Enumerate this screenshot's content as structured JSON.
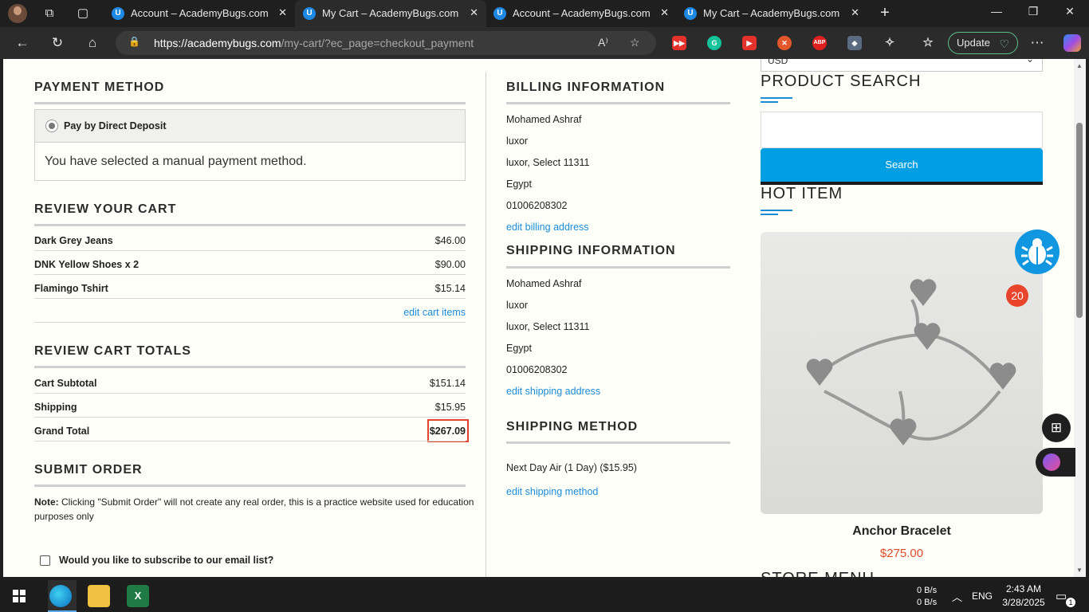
{
  "browser": {
    "tabs": [
      {
        "title": "Account – AcademyBugs.com",
        "active": false
      },
      {
        "title": "My Cart – AcademyBugs.com",
        "active": true
      },
      {
        "title": "Account – AcademyBugs.com",
        "active": false
      },
      {
        "title": "My Cart – AcademyBugs.com",
        "active": false
      }
    ],
    "url_host": "https://academybugs.com",
    "url_path": "/my-cart/?ec_page=checkout_payment",
    "update_label": "Update",
    "favicon_letter": "U",
    "ext_abp": "ABP"
  },
  "payment": {
    "heading": "PAYMENT METHOD",
    "option_label": "Pay by Direct Deposit",
    "message": "You have selected a manual payment method."
  },
  "cart": {
    "heading": "REVIEW YOUR CART",
    "items": [
      {
        "name": "Dark Grey Jeans",
        "price": "$46.00"
      },
      {
        "name": "DNK Yellow Shoes x 2",
        "price": "$90.00"
      },
      {
        "name": "Flamingo Tshirt",
        "price": "$15.14"
      }
    ],
    "edit_link": "edit cart items"
  },
  "totals": {
    "heading": "REVIEW CART TOTALS",
    "rows": [
      {
        "label": "Cart Subtotal",
        "value": "$151.14"
      },
      {
        "label": "Shipping",
        "value": "$15.95"
      },
      {
        "label": "Grand Total",
        "value": "$267.09"
      }
    ]
  },
  "submit": {
    "heading": "SUBMIT ORDER",
    "note_label": "Note:",
    "note_line1": "Clicking \"Submit Order\" will not create any real order, this is a practice website used for education",
    "note_line2": "purposes only",
    "subscribe_label": "Would you like to subscribe to our email list?"
  },
  "billing": {
    "heading": "BILLING INFORMATION",
    "lines": [
      "Mohamed Ashraf",
      "luxor",
      "luxor, Select 11311",
      "Egypt",
      "01006208302"
    ],
    "edit_link": "edit billing address"
  },
  "shipping": {
    "heading": "SHIPPING INFORMATION",
    "lines": [
      "Mohamed Ashraf",
      "luxor",
      "luxor, Select 11311",
      "Egypt",
      "01006208302"
    ],
    "edit_link": "edit shipping address"
  },
  "shipping_method": {
    "heading": "SHIPPING METHOD",
    "value": "Next Day Air (1 Day) ($15.95)",
    "edit_link": "edit shipping method"
  },
  "sidebar": {
    "currency": "USD",
    "product_search_heading": "PRODUCT SEARCH",
    "search_button": "Search",
    "hot_item_heading": "HOT ITEM",
    "product_name": "Anchor Bracelet",
    "product_price": "$275.00",
    "store_menu_heading": "STORE MENU"
  },
  "widgets": {
    "bug_count": "20"
  },
  "taskbar": {
    "net_up": "0 B/s",
    "net_down": "0 B/s",
    "lang": "ENG",
    "time": "2:43 AM",
    "date": "3/28/2025",
    "notif_count": "1"
  },
  "colors": {
    "accent": "#1a8cd8",
    "search_button": "#009ee3",
    "price": "#e04b2b",
    "highlight_border": "#e0442b"
  }
}
